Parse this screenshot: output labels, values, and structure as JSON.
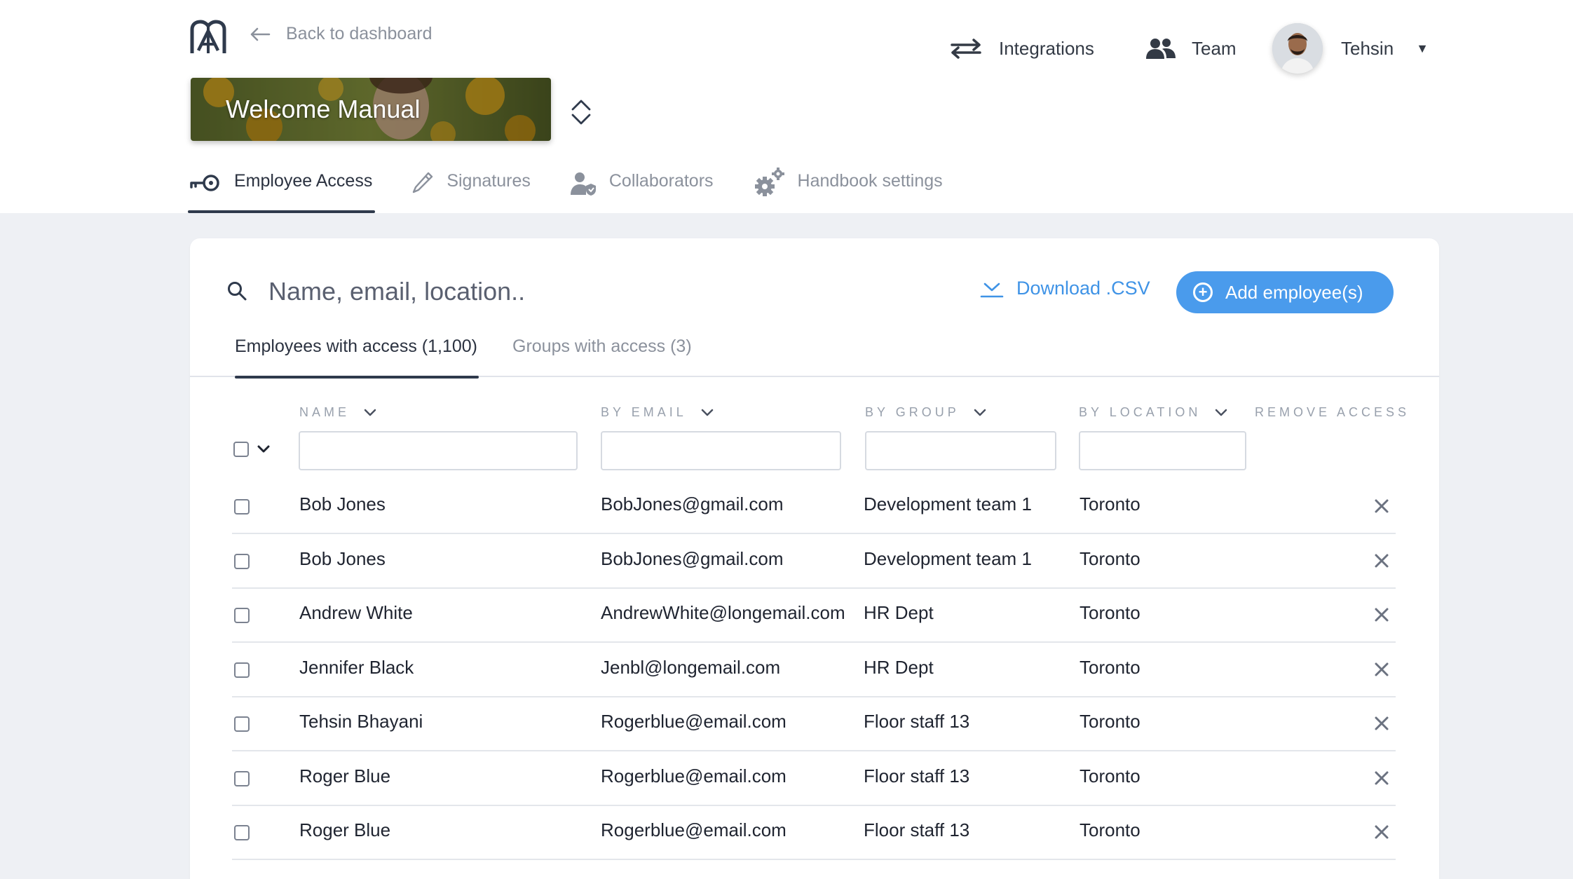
{
  "header": {
    "back_label": "Back to dashboard",
    "nav": {
      "integrations": "Integrations",
      "team": "Team",
      "user_name": "Tehsin"
    },
    "handbook_title": "Welcome Manual"
  },
  "subtabs": [
    {
      "label": "Employee Access",
      "icon": "key-icon",
      "active": true
    },
    {
      "label": "Signatures",
      "icon": "pen-icon",
      "active": false
    },
    {
      "label": "Collaborators",
      "icon": "user-shield-icon",
      "active": false
    },
    {
      "label": "Handbook settings",
      "icon": "gears-icon",
      "active": false
    }
  ],
  "search": {
    "placeholder": "Name, email, location.."
  },
  "actions": {
    "download_label": "Download .CSV",
    "add_label": "Add employee(s)"
  },
  "access_tabs": [
    {
      "label": "Employees with access (1,100)",
      "active": true
    },
    {
      "label": "Groups with access (3)",
      "active": false
    }
  ],
  "columns": {
    "name": "NAME",
    "email": "BY EMAIL",
    "group": "BY GROUP",
    "location": "BY LOCATION",
    "remove": "REMOVE ACCESS"
  },
  "rows": [
    {
      "name": "Bob Jones",
      "email": "BobJones@gmail.com",
      "group": "Development team 1",
      "location": "Toronto"
    },
    {
      "name": "Bob Jones",
      "email": "BobJones@gmail.com",
      "group": "Development team 1",
      "location": "Toronto"
    },
    {
      "name": "Andrew White",
      "email": "AndrewWhite@longemail.com",
      "group": "HR Dept",
      "location": "Toronto"
    },
    {
      "name": "Jennifer Black",
      "email": "Jenbl@longemail.com",
      "group": "HR Dept",
      "location": "Toronto"
    },
    {
      "name": "Tehsin Bhayani",
      "email": "Rogerblue@email.com",
      "group": "Floor staff 13",
      "location": "Toronto"
    },
    {
      "name": "Roger Blue",
      "email": "Rogerblue@email.com",
      "group": "Floor staff 13",
      "location": "Toronto"
    },
    {
      "name": "Roger Blue",
      "email": "Rogerblue@email.com",
      "group": "Floor staff 13",
      "location": "Toronto"
    }
  ],
  "colors": {
    "accent": "#4a9bec",
    "link": "#3f93e6",
    "text": "#1f2430",
    "muted": "#8b919c",
    "page_bg": "#eef0f4"
  }
}
